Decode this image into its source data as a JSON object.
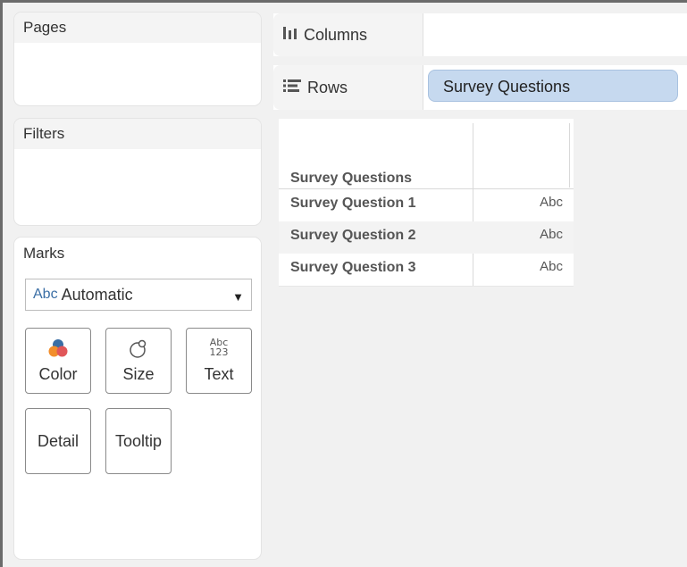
{
  "left_panels": {
    "pages_title": "Pages",
    "filters_title": "Filters",
    "marks_title": "Marks"
  },
  "marks": {
    "mark_type_icon_text": "Abc",
    "mark_type": "Automatic",
    "cards": {
      "color": "Color",
      "size": "Size",
      "text": "Text",
      "text_icon_top": "Abc",
      "text_icon_bottom": "123",
      "detail": "Detail",
      "tooltip": "Tooltip"
    }
  },
  "shelves": {
    "columns_label": "Columns",
    "rows_label": "Rows",
    "rows_pill": "Survey Questions"
  },
  "view": {
    "header": "Survey Questions",
    "rows": [
      {
        "question": "Survey Question 1",
        "value": "Abc"
      },
      {
        "question": "Survey Question 2",
        "value": "Abc"
      },
      {
        "question": "Survey Question 3",
        "value": "Abc"
      }
    ]
  },
  "icons": {
    "columns": "columns-icon",
    "rows": "rows-icon",
    "color": "color-icon",
    "size": "size-icon",
    "text": "text-icon",
    "dropdown": "chevron-down-icon"
  },
  "colors": {
    "pill_bg": "#c6d9ef",
    "abc_blue": "#3a6ea5"
  }
}
